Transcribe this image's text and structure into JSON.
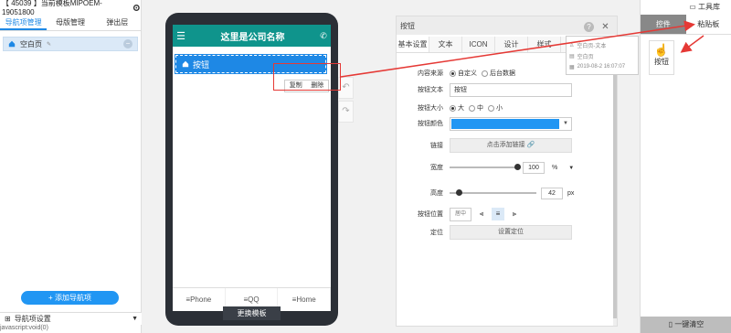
{
  "header": {
    "site_id": "【 45039 】当前模板MIPOEM-19051800"
  },
  "sidebar": {
    "tabs": [
      "导航项管理",
      "母版管理",
      "弹出层"
    ],
    "items": [
      {
        "label": "空白页"
      }
    ],
    "add_button": "+ 添加导航项",
    "settings_label": "导航项设置"
  },
  "status_text": "javascript:void(0)",
  "phone": {
    "title": "这里是公司名称",
    "button_label": "按钮",
    "context_menu": {
      "copy": "复制",
      "delete": "删除"
    },
    "footer": [
      "Phone",
      "QQ",
      "Home"
    ],
    "change_template": "更换模板"
  },
  "panel": {
    "title": "按钮",
    "tabs": [
      "基本设置",
      "文本",
      "ICON",
      "设计",
      "样式"
    ],
    "content_source": {
      "label": "内容来源",
      "options": [
        "自定义",
        "后台数据"
      ],
      "selected": 0
    },
    "button_text": {
      "label": "按钮文本",
      "value": "按钮"
    },
    "button_size": {
      "label": "按钮大小",
      "options": [
        "大",
        "中",
        "小"
      ],
      "selected": 0
    },
    "button_color": {
      "label": "按钮颜色",
      "value": "#2196f3"
    },
    "link": {
      "label": "链接",
      "button": "点击添加链接"
    },
    "width": {
      "label": "宽度",
      "value": "100",
      "unit": "%",
      "fraction": 1.0
    },
    "height": {
      "label": "高度",
      "value": "42",
      "unit": "px",
      "fraction": 0.12
    },
    "position": {
      "label": "按钮位置",
      "center_label": "居中"
    },
    "locate": {
      "label": "定位",
      "button": "设置定位"
    }
  },
  "tooltip": {
    "line1": "空白页-文本",
    "line2": "空白页",
    "line3": "2019-08-2 16:07:07"
  },
  "tools": {
    "title": "工具库",
    "tabs": [
      "控件",
      "粘贴板"
    ],
    "items": [
      {
        "label": "按钮"
      }
    ],
    "clear_button": "一键清空"
  },
  "colors": {
    "accent": "#1e88e5",
    "header_teal": "#0f948c",
    "highlight_red": "#e53935"
  }
}
